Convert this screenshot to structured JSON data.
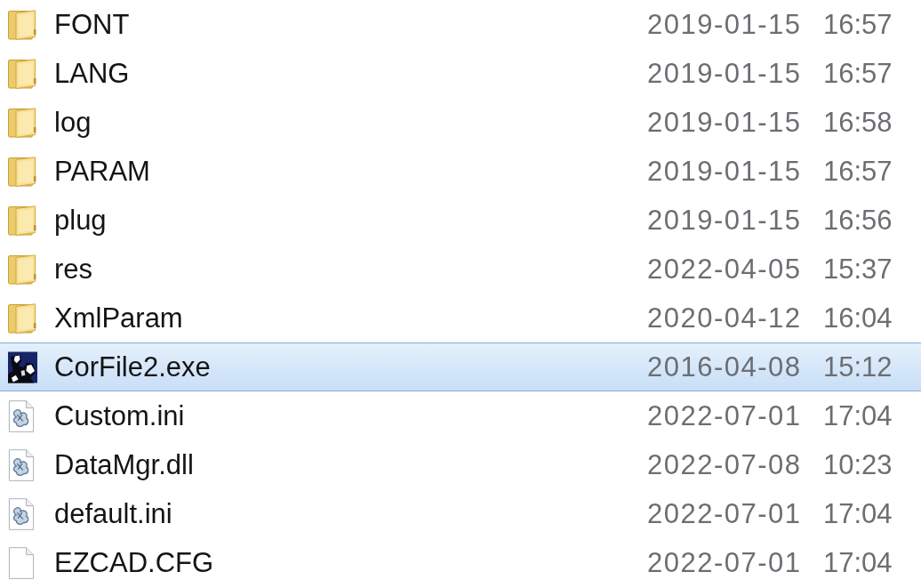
{
  "files": [
    {
      "name": "FONT",
      "kind": "folder",
      "date": "2019-01-15",
      "time": "16:57",
      "selected": false
    },
    {
      "name": "LANG",
      "kind": "folder",
      "date": "2019-01-15",
      "time": "16:57",
      "selected": false
    },
    {
      "name": "log",
      "kind": "folder",
      "date": "2019-01-15",
      "time": "16:58",
      "selected": false
    },
    {
      "name": "PARAM",
      "kind": "folder",
      "date": "2019-01-15",
      "time": "16:57",
      "selected": false
    },
    {
      "name": "plug",
      "kind": "folder",
      "date": "2019-01-15",
      "time": "16:56",
      "selected": false
    },
    {
      "name": "res",
      "kind": "folder",
      "date": "2022-04-05",
      "time": "15:37",
      "selected": false
    },
    {
      "name": "XmlParam",
      "kind": "folder",
      "date": "2020-04-12",
      "time": "16:04",
      "selected": false
    },
    {
      "name": "CorFile2.exe",
      "kind": "program",
      "date": "2016-04-08",
      "time": "15:12",
      "selected": true
    },
    {
      "name": "Custom.ini",
      "kind": "config",
      "date": "2022-07-01",
      "time": "17:04",
      "selected": false
    },
    {
      "name": "DataMgr.dll",
      "kind": "config",
      "date": "2022-07-08",
      "time": "10:23",
      "selected": false
    },
    {
      "name": "default.ini",
      "kind": "config",
      "date": "2022-07-01",
      "time": "17:04",
      "selected": false
    },
    {
      "name": "EZCAD.CFG",
      "kind": "blank",
      "date": "2022-07-01",
      "time": "17:04",
      "selected": false
    }
  ]
}
